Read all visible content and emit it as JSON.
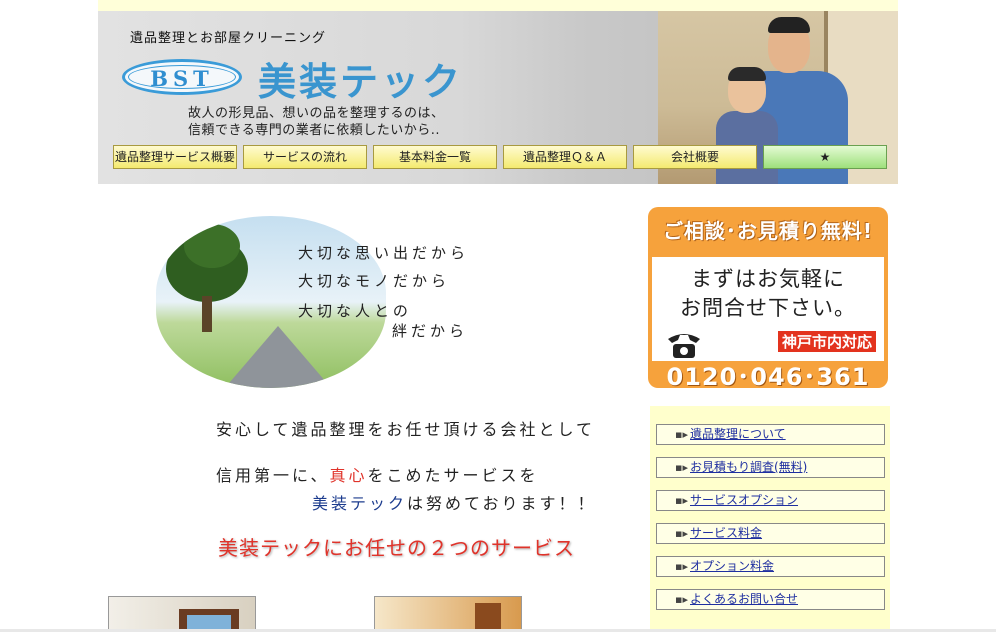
{
  "header": {
    "tagline": "遺品整理とお部屋クリーニング",
    "logo_text": "BST",
    "brand_name": "美装テック",
    "intro_line1": "故人の形見品、想いの品を整理するのは、",
    "intro_line2": "信頼できる専門の業者に依頼したいから.."
  },
  "nav": {
    "items": [
      {
        "label": "遺品整理サービス概要"
      },
      {
        "label": "サービスの流れ"
      },
      {
        "label": "基本料金一覧"
      },
      {
        "label": "遺品整理Ｑ＆Ａ"
      },
      {
        "label": "会社概要"
      },
      {
        "label": "★"
      }
    ]
  },
  "hero": {
    "poem_line1": "大切な思い出だから",
    "poem_line2": "大切なモノだから",
    "poem_line3": "大切な人との",
    "poem_line4": "絆だから"
  },
  "message": {
    "line1": "安心して遺品整理をお任せ頂ける会社として",
    "line2_a": "信用第一に、",
    "line2_b": "真心",
    "line2_c": "をこめたサービスを",
    "line3_a": "美装テック",
    "line3_b": "は努めております！！",
    "services_heading": "美装テックにお任せの２つのサービス"
  },
  "cta": {
    "title": "ご相談･お見積り無料!",
    "line1": "まずはお気軽に",
    "line2": "お問合せ下さい。",
    "area": "神戸市内対応",
    "phone": "0120･046･361"
  },
  "side_menu": {
    "items": [
      {
        "label": "遺品整理について"
      },
      {
        "label": "お見積もり調査(無料)"
      },
      {
        "label": "サービスオプション"
      },
      {
        "label": "サービス料金"
      },
      {
        "label": "オプション料金"
      },
      {
        "label": "よくあるお問い合せ"
      }
    ]
  },
  "colors": {
    "accent_red": "#e0332a",
    "brand_blue": "#3a95cf",
    "nav_yellow": "#f4ea70",
    "cta_orange": "#f6a23c",
    "link_blue": "#1f2fa0"
  }
}
